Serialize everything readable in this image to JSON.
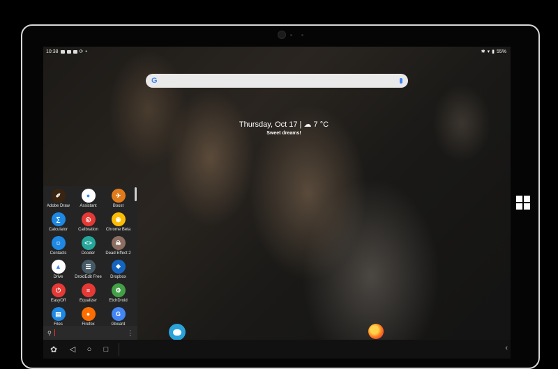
{
  "status_bar": {
    "time": "10:38",
    "dot": "•",
    "battery": "55%"
  },
  "glance": {
    "date": "Thursday, Oct 17",
    "separator": "|",
    "weather": "7 °C",
    "message": "Sweet dreams!"
  },
  "search_bar": {
    "logo": "G"
  },
  "drawer": {
    "apps": [
      {
        "label": "Adobe Draw",
        "color": "#3a2410",
        "glyph": "✐"
      },
      {
        "label": "Assistant",
        "color": "#ffffff",
        "glyph": "●"
      },
      {
        "label": "Boost",
        "color": "#e07b1b",
        "glyph": "✈"
      },
      {
        "label": "Calculator",
        "color": "#1e88e5",
        "glyph": "∑"
      },
      {
        "label": "Calibration",
        "color": "#e53935",
        "glyph": "◎"
      },
      {
        "label": "Chrome Beta",
        "color": "#fbbc05",
        "glyph": "◉"
      },
      {
        "label": "Contacts",
        "color": "#1e88e5",
        "glyph": "☺"
      },
      {
        "label": "Dcoder",
        "color": "#26a69a",
        "glyph": "<>"
      },
      {
        "label": "Dead Effect 2",
        "color": "#8d6e63",
        "glyph": "☠"
      },
      {
        "label": "Drive",
        "color": "#ffffff",
        "glyph": "▲"
      },
      {
        "label": "DroidEdit Free",
        "color": "#455a64",
        "glyph": "☰"
      },
      {
        "label": "Dropbox",
        "color": "#1565c0",
        "glyph": "❖"
      },
      {
        "label": "EasyOff",
        "color": "#e53935",
        "glyph": "⏻"
      },
      {
        "label": "Equalizer",
        "color": "#e53935",
        "glyph": "≡"
      },
      {
        "label": "EtchDroid",
        "color": "#43a047",
        "glyph": "⚙"
      },
      {
        "label": "Files",
        "color": "#1e88e5",
        "glyph": "▤"
      },
      {
        "label": "Firefox",
        "color": "#ff6d00",
        "glyph": "●"
      },
      {
        "label": "Gboard",
        "color": "#4285f4",
        "glyph": "G"
      }
    ]
  },
  "colors": {
    "accent": "#4285f4",
    "drawer_bg": "#242424"
  }
}
